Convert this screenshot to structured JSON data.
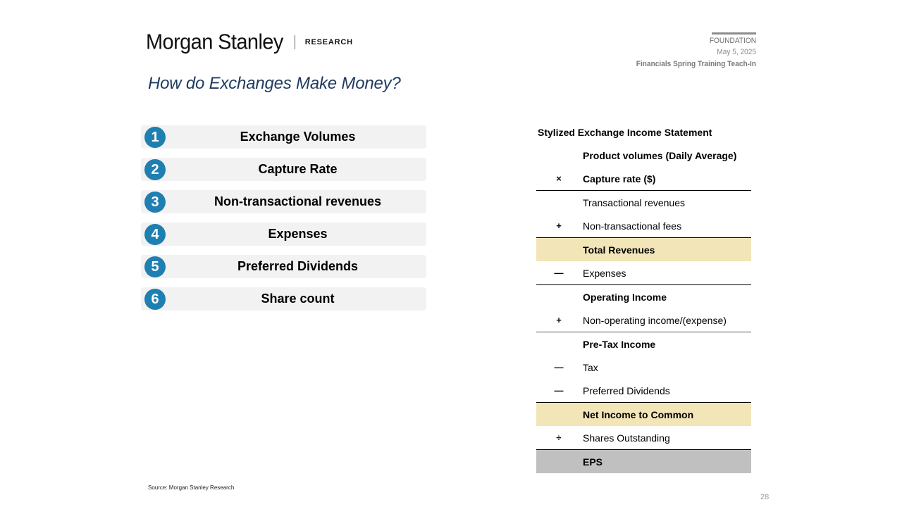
{
  "header": {
    "brand": "Morgan Stanley",
    "section": "RESEARCH",
    "corner_label": "FOUNDATION",
    "date": "May 5, 2025",
    "event": "Financials Spring Training Teach-In"
  },
  "title": "How do Exchanges Make Money?",
  "steps": [
    {
      "num": "1",
      "label": "Exchange Volumes"
    },
    {
      "num": "2",
      "label": "Capture Rate"
    },
    {
      "num": "3",
      "label": "Non-transactional revenues"
    },
    {
      "num": "4",
      "label": "Expenses"
    },
    {
      "num": "5",
      "label": "Preferred Dividends"
    },
    {
      "num": "6",
      "label": "Share count"
    }
  ],
  "statement": {
    "title": "Stylized Exchange Income Statement",
    "rows": [
      {
        "op": "",
        "label": "Product volumes (Daily Average)"
      },
      {
        "op": "×",
        "label": "Capture rate ($)"
      },
      {
        "op": "",
        "label": "Transactional revenues"
      },
      {
        "op": "+",
        "label": "Non-transactional fees"
      },
      {
        "op": "",
        "label": "Total Revenues"
      },
      {
        "op": "—",
        "label": "Expenses"
      },
      {
        "op": "",
        "label": "Operating Income"
      },
      {
        "op": "+",
        "label": "Non-operating income/(expense)"
      },
      {
        "op": "",
        "label": "Pre-Tax Income"
      },
      {
        "op": "—",
        "label": "Tax"
      },
      {
        "op": "—",
        "label": "Preferred Dividends"
      },
      {
        "op": "",
        "label": "Net Income to Common"
      },
      {
        "op": "÷",
        "label": "Shares Outstanding"
      },
      {
        "op": "",
        "label": "EPS"
      }
    ],
    "highlight_color": "#f2e5b8",
    "eps_color": "#c0c0c0"
  },
  "footer": {
    "source": "Source: Morgan Stanley Research",
    "page": "28"
  },
  "colors": {
    "title": "#1f3a5f",
    "step_badge": "#1f7fb0",
    "step_bar": "#f2f2f2"
  }
}
